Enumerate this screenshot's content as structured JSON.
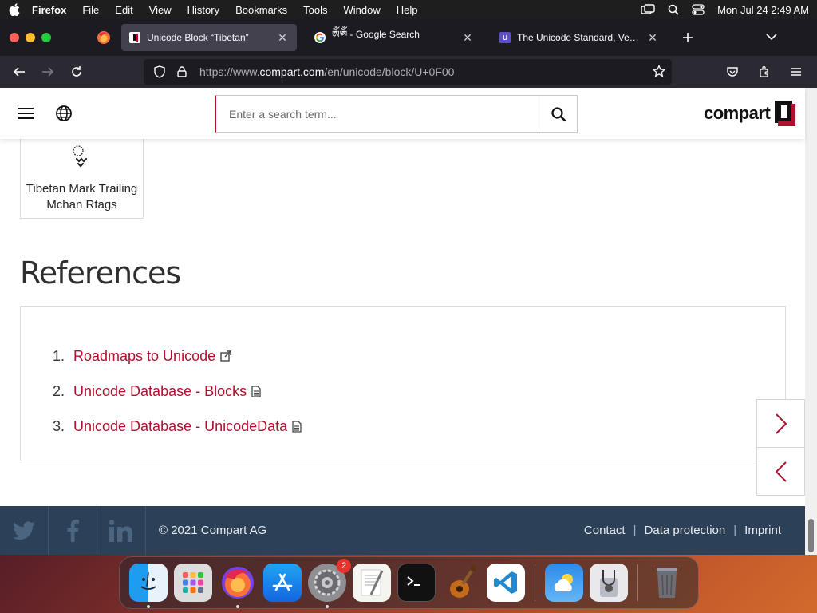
{
  "menubar": {
    "app_name": "Firefox",
    "items": [
      "File",
      "Edit",
      "View",
      "History",
      "Bookmarks",
      "Tools",
      "Window",
      "Help"
    ],
    "clock": "Mon Jul 24  2:49 AM"
  },
  "tabs": [
    {
      "title": "Unicode Block “Tibetan”",
      "active": true
    },
    {
      "title": "ༀༀ - Google Search",
      "active": false
    },
    {
      "title": "The Unicode Standard, Version",
      "active": false
    }
  ],
  "address": {
    "prefix": "https://www.",
    "domain": "compart.com",
    "path": "/en/unicode/block/U+0F00"
  },
  "site": {
    "search_placeholder": "Enter a search term...",
    "logo_text": "compart"
  },
  "character_card": {
    "name": "Tibetan Mark Trailing Mchan Rtags"
  },
  "references": {
    "title": "References",
    "items": [
      {
        "num": "1.",
        "label": "Roadmaps to Unicode",
        "icon": "external-link-icon"
      },
      {
        "num": "2.",
        "label": "Unicode Database - Blocks",
        "icon": "document-icon"
      },
      {
        "num": "3.",
        "label": "Unicode Database - UnicodeData",
        "icon": "document-icon"
      }
    ]
  },
  "footer": {
    "copyright": "© 2021 Compart AG",
    "links": [
      "Contact",
      "Data protection",
      "Imprint"
    ]
  },
  "dock": {
    "settings_badge": "2"
  },
  "colors": {
    "accent": "#b0102e",
    "footer_bg": "#2c4157",
    "chrome_bg": "#1c1b22"
  }
}
